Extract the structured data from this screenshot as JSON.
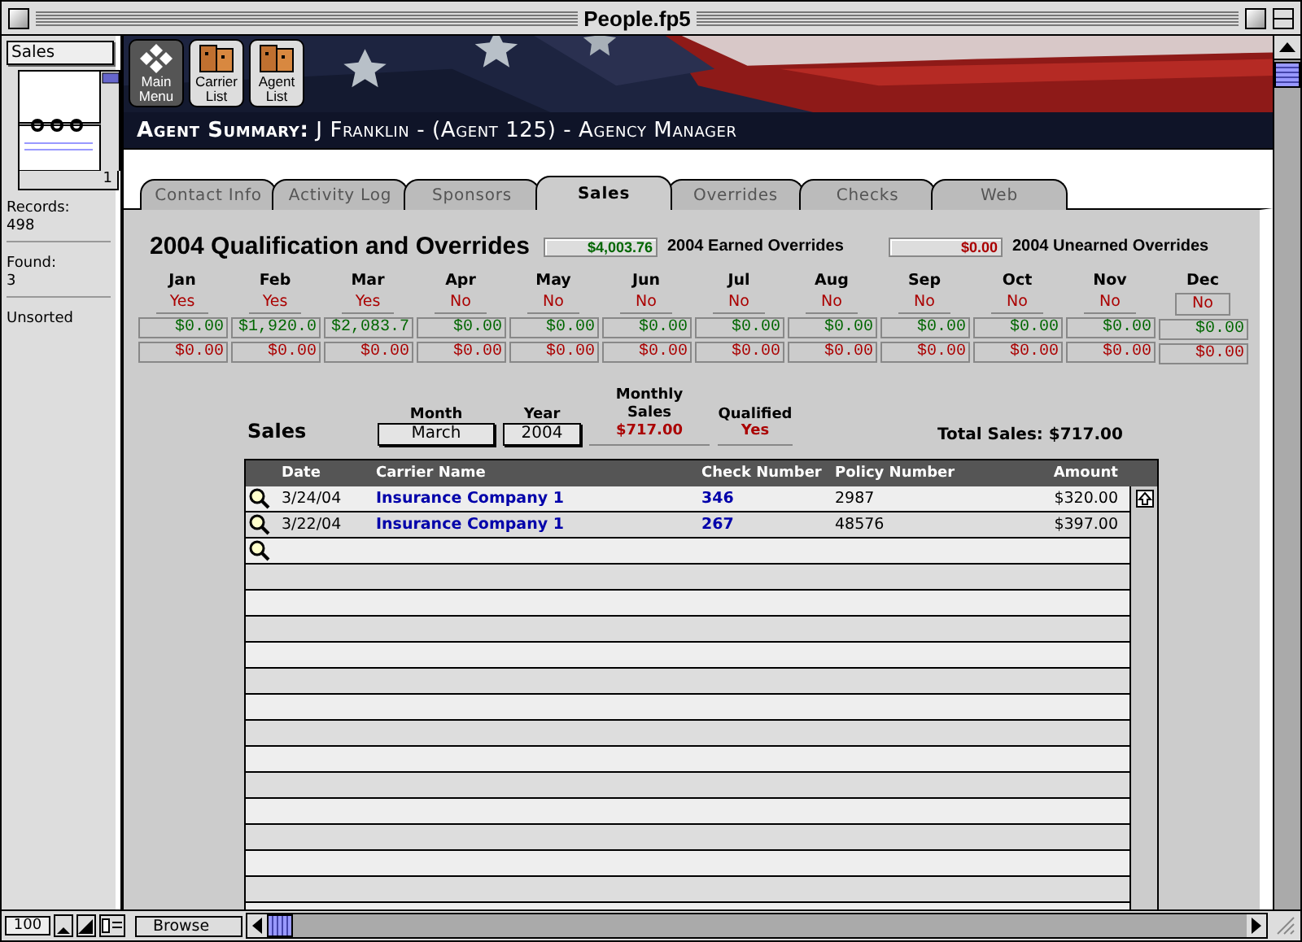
{
  "window": {
    "title": "People.fp5"
  },
  "status_area": {
    "layout": "Sales",
    "book_page": "1",
    "records_label": "Records:",
    "records": "498",
    "found_label": "Found:",
    "found": "3",
    "sort": "Unsorted"
  },
  "nav_buttons": [
    {
      "label": "Main Menu",
      "selected": true
    },
    {
      "label": "Carrier List",
      "selected": false
    },
    {
      "label": "Agent List",
      "selected": false
    }
  ],
  "header_title": "**Agent Summary:** J Franklin - (Agent 125) - Agency Manager",
  "tabs": [
    {
      "label": "Contact Info",
      "selected": false
    },
    {
      "label": "Activity Log",
      "selected": false
    },
    {
      "label": "Sponsors",
      "selected": false
    },
    {
      "label": "Sales",
      "selected": true
    },
    {
      "label": "Overrides",
      "selected": false
    },
    {
      "label": "Checks",
      "selected": false
    },
    {
      "label": "Web",
      "selected": false
    }
  ],
  "qualification": {
    "title": "2004 Qualification and Overrides",
    "earned": "$4,003.76",
    "earned_label": "2004 Earned Overrides",
    "unearned": "$0.00",
    "unearned_label": "2004 Unearned Overrides",
    "months": [
      {
        "name": "Jan",
        "qualified": "Yes",
        "earned": "$0.00",
        "unearned": "$0.00",
        "focused": false
      },
      {
        "name": "Feb",
        "qualified": "Yes",
        "earned": "$1,920.0",
        "unearned": "$0.00",
        "focused": false
      },
      {
        "name": "Mar",
        "qualified": "Yes",
        "earned": "$2,083.7",
        "unearned": "$0.00",
        "focused": false
      },
      {
        "name": "Apr",
        "qualified": "No",
        "earned": "$0.00",
        "unearned": "$0.00",
        "focused": false
      },
      {
        "name": "May",
        "qualified": "No",
        "earned": "$0.00",
        "unearned": "$0.00",
        "focused": false
      },
      {
        "name": "Jun",
        "qualified": "No",
        "earned": "$0.00",
        "unearned": "$0.00",
        "focused": false
      },
      {
        "name": "Jul",
        "qualified": "No",
        "earned": "$0.00",
        "unearned": "$0.00",
        "focused": false
      },
      {
        "name": "Aug",
        "qualified": "No",
        "earned": "$0.00",
        "unearned": "$0.00",
        "focused": false
      },
      {
        "name": "Sep",
        "qualified": "No",
        "earned": "$0.00",
        "unearned": "$0.00",
        "focused": false
      },
      {
        "name": "Oct",
        "qualified": "No",
        "earned": "$0.00",
        "unearned": "$0.00",
        "focused": false
      },
      {
        "name": "Nov",
        "qualified": "No",
        "earned": "$0.00",
        "unearned": "$0.00",
        "focused": false
      },
      {
        "name": "Dec",
        "qualified": "No",
        "earned": "$0.00",
        "unearned": "$0.00",
        "focused": true
      }
    ]
  },
  "sales": {
    "title": "Sales",
    "month_label": "Month",
    "month": "March",
    "year_label": "Year",
    "year": "2004",
    "monthly_sales_label": "Monthly Sales",
    "monthly_sales": "$717.00",
    "qualified_label": "Qualified",
    "qualified": "Yes",
    "total": "Total Sales: $717.00",
    "columns": [
      "Date",
      "Carrier Name",
      "Check Number",
      "Policy Number",
      "Amount"
    ],
    "rows": [
      {
        "date": "3/24/04",
        "carrier": "Insurance Company 1",
        "check": "346",
        "policy": "2987",
        "amount": "$320.00"
      },
      {
        "date": "3/22/04",
        "carrier": "Insurance Company 1",
        "check": "267",
        "policy": "48576",
        "amount": "$397.00"
      }
    ]
  },
  "bottom_bar": {
    "zoom": "100",
    "mode": "Browse"
  }
}
